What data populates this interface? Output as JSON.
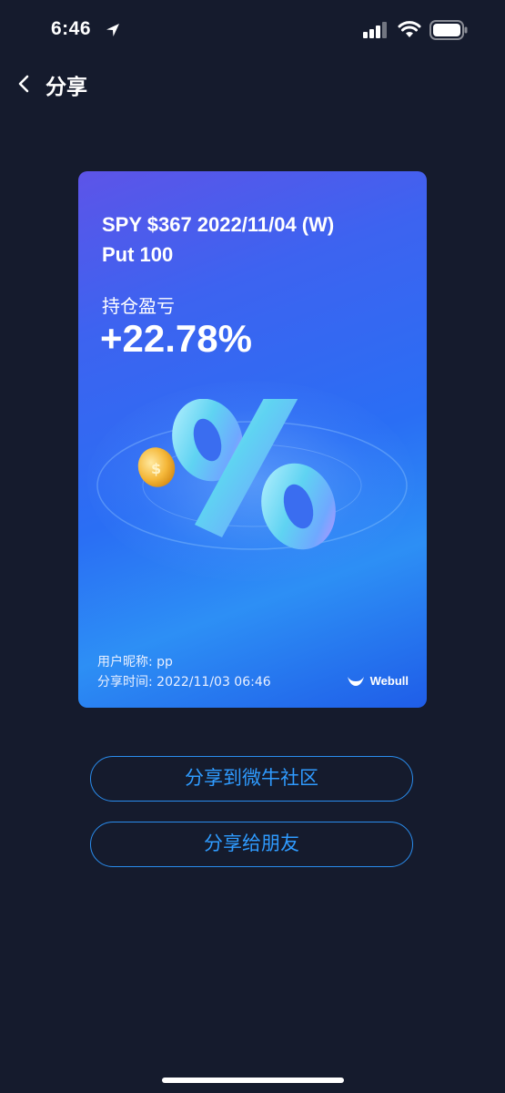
{
  "status_bar": {
    "time": "6:46"
  },
  "header": {
    "title": "分享",
    "back_icon": "chevron-left-icon"
  },
  "card": {
    "title_line1": "SPY $367 2022/11/04 (W)",
    "title_line2": "Put 100",
    "pl_label": "持仓盈亏",
    "pl_value": "+22.78%",
    "nickname": "用户昵称: pp",
    "share_time": "分享时间: 2022/11/03 06:46",
    "brand": "Webull"
  },
  "buttons": {
    "share_community": "分享到微牛社区",
    "share_friends": "分享给朋友"
  },
  "colors": {
    "background": "#151b2d",
    "accent": "#2f9bff"
  }
}
